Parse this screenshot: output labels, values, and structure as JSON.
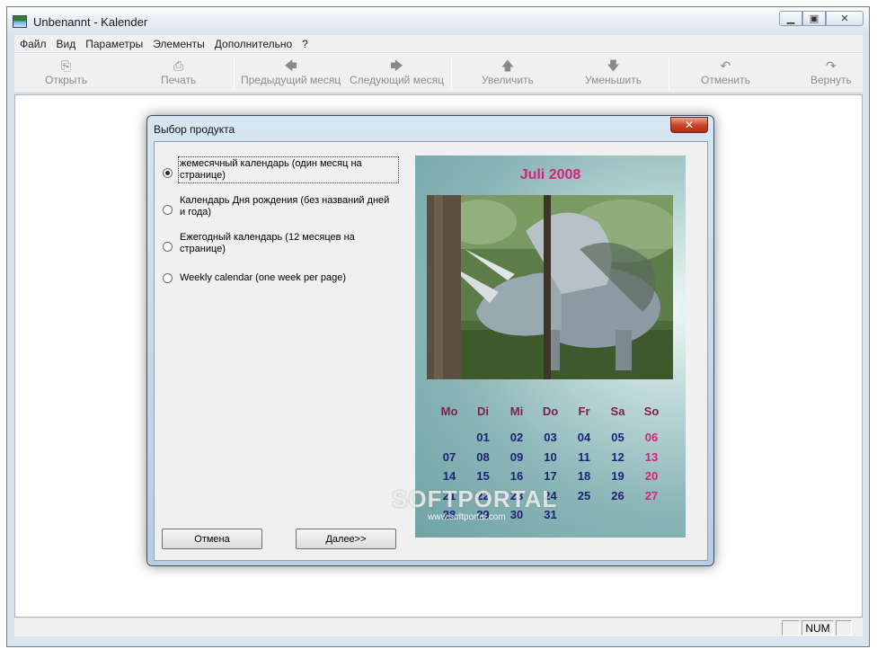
{
  "window": {
    "title": "Unbenannt - Kalender",
    "controls": {
      "minimize": "▁",
      "maximize": "▣",
      "close": "✕"
    }
  },
  "menu": [
    "Файл",
    "Вид",
    "Параметры",
    "Элементы",
    "Дополнительно",
    "?"
  ],
  "toolbar": {
    "open": {
      "label": "Открыть",
      "icon": "open-folder-icon"
    },
    "print": {
      "label": "Печать",
      "icon": "printer-icon"
    },
    "prev_month": {
      "label": "Предыдущий месяц",
      "icon": "arrow-left-icon"
    },
    "next_month": {
      "label": "Следующий месяц",
      "icon": "arrow-right-icon"
    },
    "zoom_in": {
      "label": "Увеличить",
      "icon": "arrow-up-icon"
    },
    "zoom_out": {
      "label": "Уменьшить",
      "icon": "arrow-down-icon"
    },
    "undo": {
      "label": "Отменить",
      "icon": "undo-icon"
    },
    "redo": {
      "label": "Вернуть",
      "icon": "redo-icon"
    }
  },
  "statusbar": {
    "num": "NUM"
  },
  "dialog": {
    "title": "Выбор продукта",
    "close": "✕",
    "options": [
      {
        "label": "жемесячный календарь (один месяц на странице)",
        "checked": true
      },
      {
        "label": "Календарь Дня рождения (без названий дней и года)",
        "checked": false
      },
      {
        "label": "Ежегодный календарь (12 месяцев на странице)",
        "checked": false
      },
      {
        "label": "Weekly calendar (one week per page)",
        "checked": false
      }
    ],
    "cancel": "Отмена",
    "next": "Далее>>",
    "preview": {
      "title": "Juli 2008",
      "weekdays": [
        "Mo",
        "Di",
        "Mi",
        "Do",
        "Fr",
        "Sa",
        "So"
      ],
      "weeks": [
        [
          "",
          "01",
          "02",
          "03",
          "04",
          "05",
          "06"
        ],
        [
          "07",
          "08",
          "09",
          "10",
          "11",
          "12",
          "13"
        ],
        [
          "14",
          "15",
          "16",
          "17",
          "18",
          "19",
          "20"
        ],
        [
          "21",
          "22",
          "23",
          "24",
          "25",
          "26",
          "27"
        ],
        [
          "28",
          "29",
          "30",
          "31",
          "",
          "",
          ""
        ]
      ],
      "colors": {
        "title": "#d1237b",
        "weekday": "#7d1f4e",
        "day": "#1c2277",
        "sunday": "#d1237b"
      }
    }
  },
  "watermark": {
    "main": "SOFTPORTAL",
    "sub": "www.softportal.com"
  }
}
